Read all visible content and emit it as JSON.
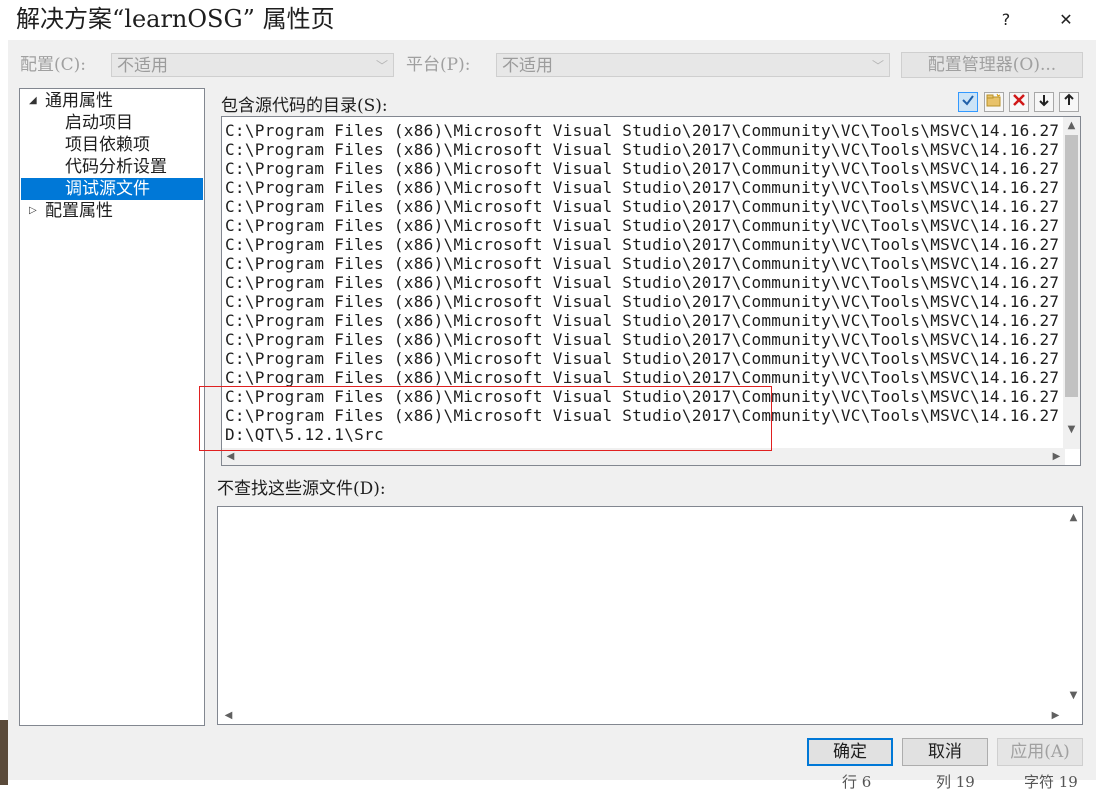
{
  "window": {
    "title": "解决方案“learnOSG” 属性页",
    "help_label": "?",
    "close_label": "✕"
  },
  "config_bar": {
    "config_label": "配置(C):",
    "config_value": "不适用",
    "platform_label": "平台(P):",
    "platform_value": "不适用",
    "config_manager_label": "配置管理器(O)..."
  },
  "tree": {
    "items": [
      {
        "label": "通用属性",
        "expander": "◢"
      },
      {
        "label": "启动项目"
      },
      {
        "label": "项目依赖项"
      },
      {
        "label": "代码分析设置"
      },
      {
        "label": "调试源文件"
      },
      {
        "label": "配置属性",
        "expander": "▷"
      }
    ]
  },
  "source_dirs": {
    "label": "包含源代码的目录(S):",
    "lines": [
      "C:\\Program Files (x86)\\Microsoft Visual Studio\\2017\\Community\\VC\\Tools\\MSVC\\14.16.27",
      "C:\\Program Files (x86)\\Microsoft Visual Studio\\2017\\Community\\VC\\Tools\\MSVC\\14.16.27",
      "C:\\Program Files (x86)\\Microsoft Visual Studio\\2017\\Community\\VC\\Tools\\MSVC\\14.16.27",
      "C:\\Program Files (x86)\\Microsoft Visual Studio\\2017\\Community\\VC\\Tools\\MSVC\\14.16.27",
      "C:\\Program Files (x86)\\Microsoft Visual Studio\\2017\\Community\\VC\\Tools\\MSVC\\14.16.27",
      "C:\\Program Files (x86)\\Microsoft Visual Studio\\2017\\Community\\VC\\Tools\\MSVC\\14.16.27",
      "C:\\Program Files (x86)\\Microsoft Visual Studio\\2017\\Community\\VC\\Tools\\MSVC\\14.16.27",
      "C:\\Program Files (x86)\\Microsoft Visual Studio\\2017\\Community\\VC\\Tools\\MSVC\\14.16.27",
      "C:\\Program Files (x86)\\Microsoft Visual Studio\\2017\\Community\\VC\\Tools\\MSVC\\14.16.27",
      "C:\\Program Files (x86)\\Microsoft Visual Studio\\2017\\Community\\VC\\Tools\\MSVC\\14.16.27",
      "C:\\Program Files (x86)\\Microsoft Visual Studio\\2017\\Community\\VC\\Tools\\MSVC\\14.16.27",
      "C:\\Program Files (x86)\\Microsoft Visual Studio\\2017\\Community\\VC\\Tools\\MSVC\\14.16.27",
      "C:\\Program Files (x86)\\Microsoft Visual Studio\\2017\\Community\\VC\\Tools\\MSVC\\14.16.27",
      "C:\\Program Files (x86)\\Microsoft Visual Studio\\2017\\Community\\VC\\Tools\\MSVC\\14.16.27",
      "C:\\Program Files (x86)\\Microsoft Visual Studio\\2017\\Community\\VC\\Tools\\MSVC\\14.16.27",
      "C:\\Program Files (x86)\\Microsoft Visual Studio\\2017\\Community\\VC\\Tools\\MSVC\\14.16.27",
      "D:\\QT\\5.12.1\\Src",
      "C:\\Program Files (x86)\\Microsoft Visual Studio\\2017\\Community\\VC\\Tools\\MSVC\\14.16.27"
    ],
    "toolbar_icons": [
      "checkmark-icon",
      "new-folder-icon",
      "delete-icon",
      "move-down-icon",
      "move-up-icon"
    ]
  },
  "exclude_files": {
    "label": "不查找这些源文件(D):"
  },
  "buttons": {
    "ok": "确定",
    "cancel": "取消",
    "apply": "应用(A)"
  },
  "status_bar": {
    "line": "行 6",
    "col": "列 19",
    "char": "字符 19"
  },
  "colors": {
    "selection": "#0078d7",
    "highlight_box": "#e02020"
  }
}
